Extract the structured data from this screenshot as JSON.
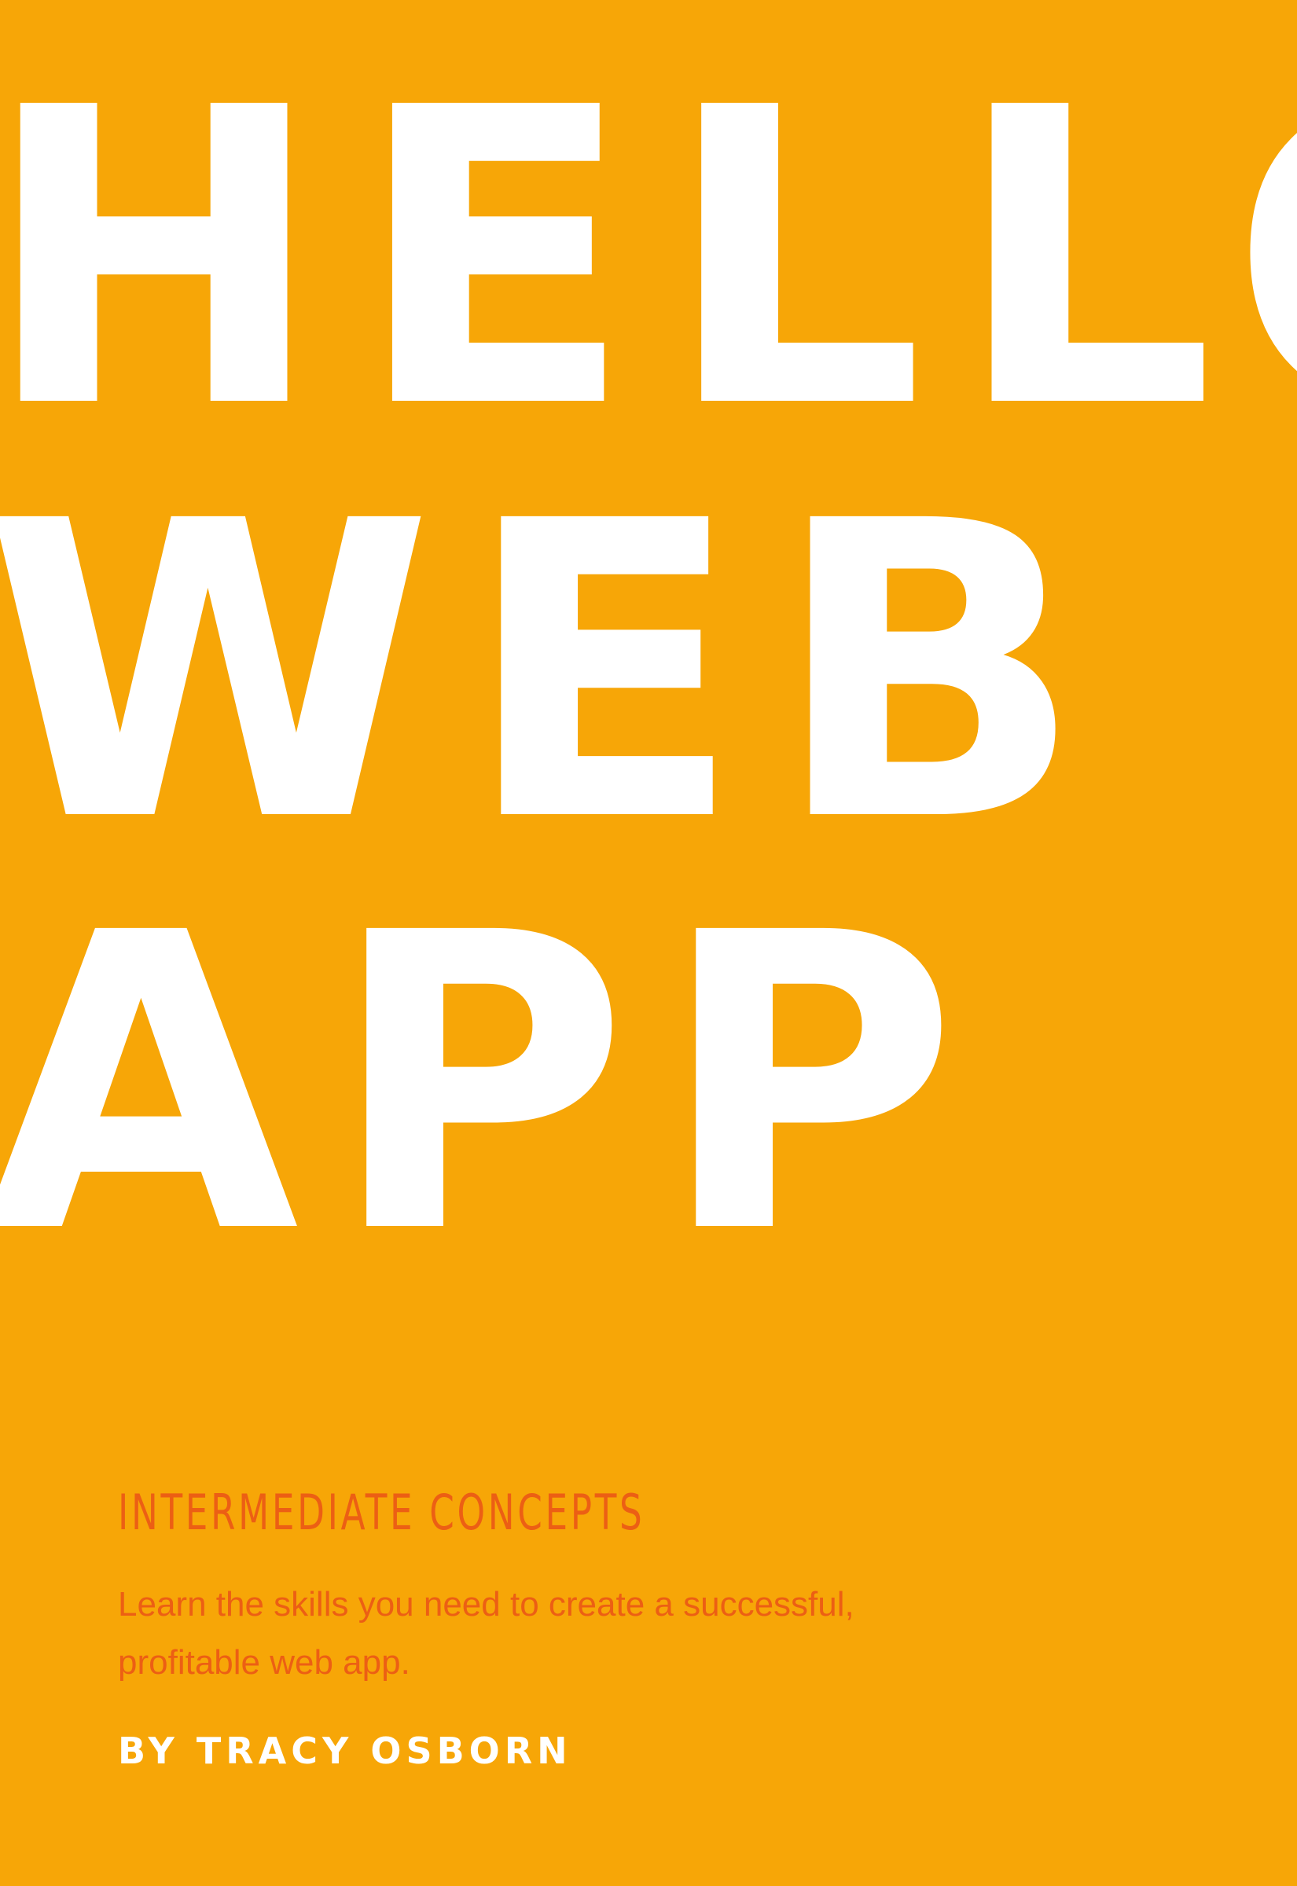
{
  "cover": {
    "title_lines": [
      "HELLO",
      "WEB",
      "APP"
    ],
    "subtitle": "INTERMEDIATE CONCEPTS",
    "description_lines": [
      "Learn the skills you need to create a successful,",
      "profitable web app."
    ],
    "author": "BY TRACY OSBORN"
  },
  "colors": {
    "background": "#F7A607",
    "title": "#FFFFFF",
    "accent": "#EC5F14",
    "author": "#FFFFFF"
  }
}
